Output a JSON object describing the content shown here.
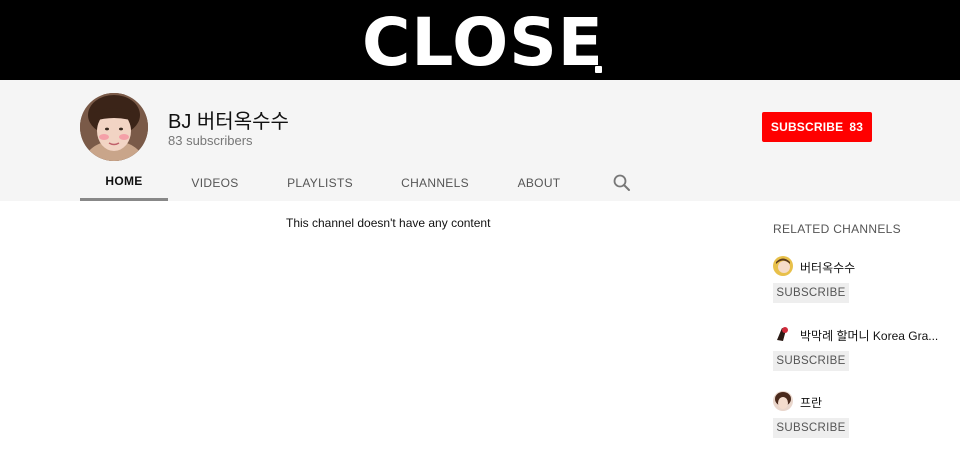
{
  "banner": {
    "logo_text": "CLOSE"
  },
  "channel": {
    "title": "BJ 버터옥수수",
    "subscribers": "83 subscribers"
  },
  "subscribe": {
    "label": "SUBSCRIBE",
    "count": "83",
    "color": "#ff0000"
  },
  "tabs": [
    "HOME",
    "VIDEOS",
    "PLAYLISTS",
    "CHANNELS",
    "ABOUT"
  ],
  "active_tab": "HOME",
  "icons": {
    "search": "search-icon"
  },
  "content": {
    "empty_message": "This channel doesn't have any content"
  },
  "related": {
    "title": "RELATED CHANNELS",
    "items": [
      {
        "name": "버터옥수수",
        "button": "SUBSCRIBE"
      },
      {
        "name": "박막례 할머니 Korea Gra...",
        "button": "SUBSCRIBE"
      },
      {
        "name": "프란",
        "button": "SUBSCRIBE"
      }
    ]
  }
}
